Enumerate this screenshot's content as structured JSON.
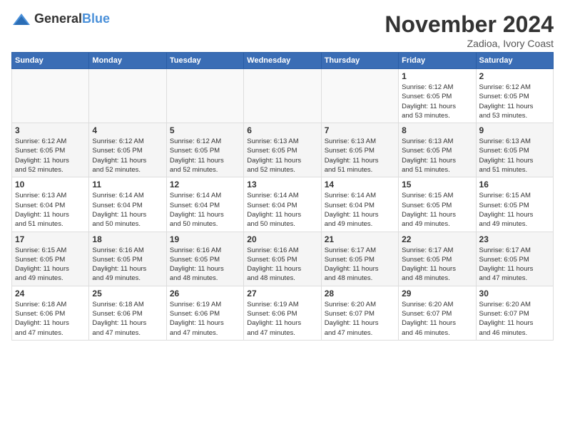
{
  "logo": {
    "text_general": "General",
    "text_blue": "Blue"
  },
  "header": {
    "month_title": "November 2024",
    "subtitle": "Zadioa, Ivory Coast"
  },
  "weekdays": [
    "Sunday",
    "Monday",
    "Tuesday",
    "Wednesday",
    "Thursday",
    "Friday",
    "Saturday"
  ],
  "weeks": [
    [
      {
        "day": "",
        "info": ""
      },
      {
        "day": "",
        "info": ""
      },
      {
        "day": "",
        "info": ""
      },
      {
        "day": "",
        "info": ""
      },
      {
        "day": "",
        "info": ""
      },
      {
        "day": "1",
        "info": "Sunrise: 6:12 AM\nSunset: 6:05 PM\nDaylight: 11 hours\nand 53 minutes."
      },
      {
        "day": "2",
        "info": "Sunrise: 6:12 AM\nSunset: 6:05 PM\nDaylight: 11 hours\nand 53 minutes."
      }
    ],
    [
      {
        "day": "3",
        "info": "Sunrise: 6:12 AM\nSunset: 6:05 PM\nDaylight: 11 hours\nand 52 minutes."
      },
      {
        "day": "4",
        "info": "Sunrise: 6:12 AM\nSunset: 6:05 PM\nDaylight: 11 hours\nand 52 minutes."
      },
      {
        "day": "5",
        "info": "Sunrise: 6:12 AM\nSunset: 6:05 PM\nDaylight: 11 hours\nand 52 minutes."
      },
      {
        "day": "6",
        "info": "Sunrise: 6:13 AM\nSunset: 6:05 PM\nDaylight: 11 hours\nand 52 minutes."
      },
      {
        "day": "7",
        "info": "Sunrise: 6:13 AM\nSunset: 6:05 PM\nDaylight: 11 hours\nand 51 minutes."
      },
      {
        "day": "8",
        "info": "Sunrise: 6:13 AM\nSunset: 6:05 PM\nDaylight: 11 hours\nand 51 minutes."
      },
      {
        "day": "9",
        "info": "Sunrise: 6:13 AM\nSunset: 6:05 PM\nDaylight: 11 hours\nand 51 minutes."
      }
    ],
    [
      {
        "day": "10",
        "info": "Sunrise: 6:13 AM\nSunset: 6:04 PM\nDaylight: 11 hours\nand 51 minutes."
      },
      {
        "day": "11",
        "info": "Sunrise: 6:14 AM\nSunset: 6:04 PM\nDaylight: 11 hours\nand 50 minutes."
      },
      {
        "day": "12",
        "info": "Sunrise: 6:14 AM\nSunset: 6:04 PM\nDaylight: 11 hours\nand 50 minutes."
      },
      {
        "day": "13",
        "info": "Sunrise: 6:14 AM\nSunset: 6:04 PM\nDaylight: 11 hours\nand 50 minutes."
      },
      {
        "day": "14",
        "info": "Sunrise: 6:14 AM\nSunset: 6:04 PM\nDaylight: 11 hours\nand 49 minutes."
      },
      {
        "day": "15",
        "info": "Sunrise: 6:15 AM\nSunset: 6:05 PM\nDaylight: 11 hours\nand 49 minutes."
      },
      {
        "day": "16",
        "info": "Sunrise: 6:15 AM\nSunset: 6:05 PM\nDaylight: 11 hours\nand 49 minutes."
      }
    ],
    [
      {
        "day": "17",
        "info": "Sunrise: 6:15 AM\nSunset: 6:05 PM\nDaylight: 11 hours\nand 49 minutes."
      },
      {
        "day": "18",
        "info": "Sunrise: 6:16 AM\nSunset: 6:05 PM\nDaylight: 11 hours\nand 49 minutes."
      },
      {
        "day": "19",
        "info": "Sunrise: 6:16 AM\nSunset: 6:05 PM\nDaylight: 11 hours\nand 48 minutes."
      },
      {
        "day": "20",
        "info": "Sunrise: 6:16 AM\nSunset: 6:05 PM\nDaylight: 11 hours\nand 48 minutes."
      },
      {
        "day": "21",
        "info": "Sunrise: 6:17 AM\nSunset: 6:05 PM\nDaylight: 11 hours\nand 48 minutes."
      },
      {
        "day": "22",
        "info": "Sunrise: 6:17 AM\nSunset: 6:05 PM\nDaylight: 11 hours\nand 48 minutes."
      },
      {
        "day": "23",
        "info": "Sunrise: 6:17 AM\nSunset: 6:05 PM\nDaylight: 11 hours\nand 47 minutes."
      }
    ],
    [
      {
        "day": "24",
        "info": "Sunrise: 6:18 AM\nSunset: 6:06 PM\nDaylight: 11 hours\nand 47 minutes."
      },
      {
        "day": "25",
        "info": "Sunrise: 6:18 AM\nSunset: 6:06 PM\nDaylight: 11 hours\nand 47 minutes."
      },
      {
        "day": "26",
        "info": "Sunrise: 6:19 AM\nSunset: 6:06 PM\nDaylight: 11 hours\nand 47 minutes."
      },
      {
        "day": "27",
        "info": "Sunrise: 6:19 AM\nSunset: 6:06 PM\nDaylight: 11 hours\nand 47 minutes."
      },
      {
        "day": "28",
        "info": "Sunrise: 6:20 AM\nSunset: 6:07 PM\nDaylight: 11 hours\nand 47 minutes."
      },
      {
        "day": "29",
        "info": "Sunrise: 6:20 AM\nSunset: 6:07 PM\nDaylight: 11 hours\nand 46 minutes."
      },
      {
        "day": "30",
        "info": "Sunrise: 6:20 AM\nSunset: 6:07 PM\nDaylight: 11 hours\nand 46 minutes."
      }
    ]
  ]
}
